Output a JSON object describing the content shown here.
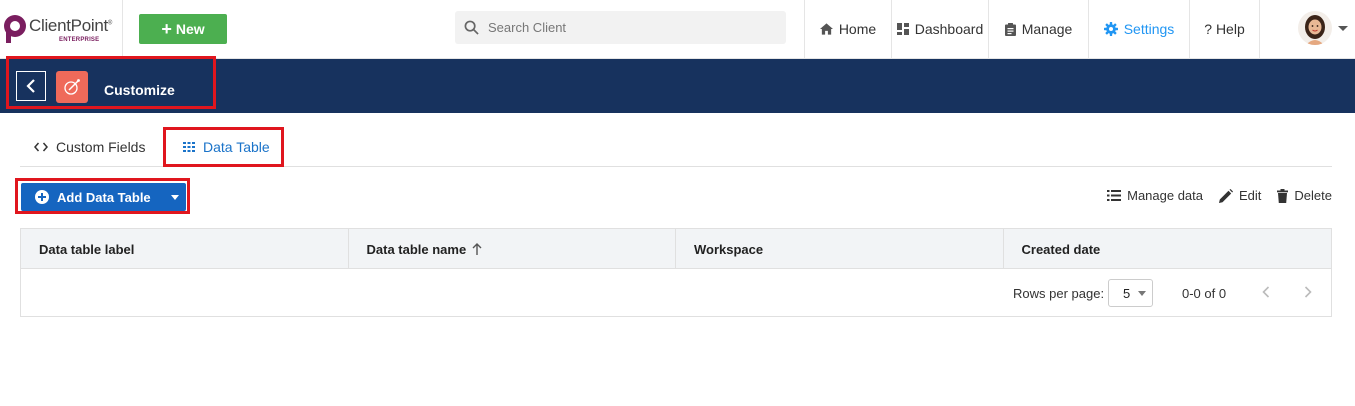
{
  "brand": {
    "name": "ClientPoint",
    "trademark": "®",
    "edition": "ENTERPRISE"
  },
  "topbar": {
    "new_label": "New",
    "search_placeholder": "Search Client",
    "nav": {
      "home": "Home",
      "dashboard": "Dashboard",
      "manage": "Manage",
      "settings": "Settings",
      "help": "? Help"
    },
    "active_nav": "settings"
  },
  "header": {
    "title": "Customize"
  },
  "tabs": [
    {
      "label": "Custom Fields",
      "active": false
    },
    {
      "label": "Data Table",
      "active": true
    }
  ],
  "toolbar": {
    "add_label": "Add Data Table",
    "manage_data": "Manage data",
    "edit": "Edit",
    "delete": "Delete"
  },
  "table": {
    "columns": [
      "Data table label",
      "Data table name",
      "Workspace",
      "Created date"
    ],
    "sorted_column": "Data table name",
    "sort_direction": "asc",
    "rows": [],
    "rows_per_page_label": "Rows per page:",
    "rows_per_page": "5",
    "range": "0-0 of 0"
  },
  "colors": {
    "navy": "#17325e",
    "new_green": "#4caf50",
    "primary_blue": "#1565c0",
    "active_blue": "#2196f3",
    "highlight_red": "#e0161e"
  }
}
